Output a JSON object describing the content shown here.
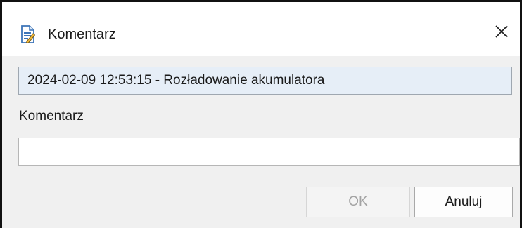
{
  "window": {
    "title": "Komentarz",
    "title_icon": "document-edit-icon",
    "close_icon": "close-icon",
    "close_glyph": "✕"
  },
  "event": {
    "text": "2024-02-09 12:53:15 - Rozładowanie akumulatora"
  },
  "comment": {
    "label": "Komentarz",
    "value": "",
    "placeholder": ""
  },
  "buttons": {
    "ok_label": "OK",
    "ok_enabled": false,
    "cancel_label": "Anuluj"
  },
  "colors": {
    "info_background": "#e6eef7",
    "dialog_background": "#f0f0f0",
    "disabled_text": "#a3a3a3"
  }
}
